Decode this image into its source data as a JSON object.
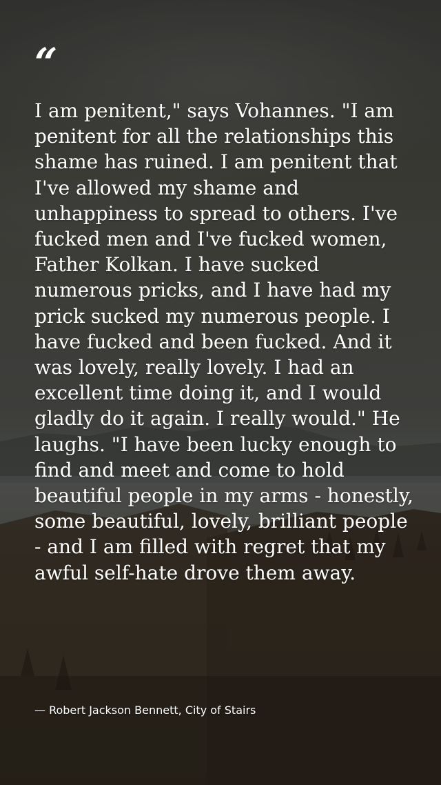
{
  "quote": {
    "mark": "“",
    "text": "I am penitent,\" says Vohannes. \"I am penitent for all the relationships this shame has ruined. I am penitent that I've allowed my shame and unhappiness to spread to others. I've fucked men and I've fucked women, Father Kolkan. I have sucked numerous pricks, and I have had my prick sucked my numerous people. I have fucked and been fucked. And it was lovely, really lovely. I had an excellent time doing it, and I would gladly do it again. I really would.\" He laughs. \"I have been lucky enough to find and meet and come to hold beautiful people in my arms - honestly, some beautiful, lovely, brilliant people - and I am filled with regret that my awful self-hate drove them away.",
    "attribution": "— Robert Jackson Bennett, City of Stairs"
  },
  "colors": {
    "text": "#ffffff",
    "sky": "#4a4a45",
    "ground": "#3b3228"
  }
}
